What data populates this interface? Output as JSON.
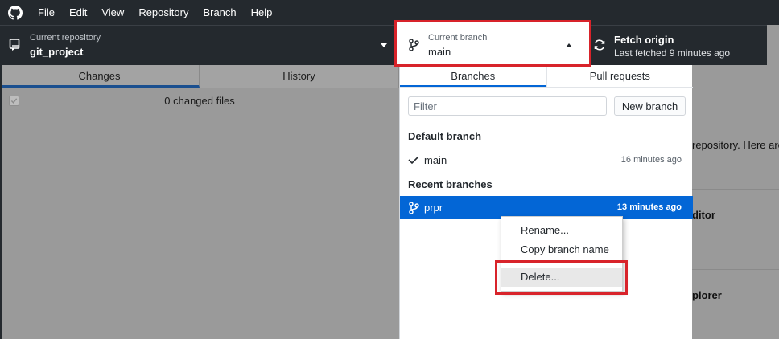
{
  "menu": {
    "logo_icon": "github-icon",
    "items": [
      "File",
      "Edit",
      "View",
      "Repository",
      "Branch",
      "Help"
    ]
  },
  "toolbar": {
    "repo": {
      "label": "Current repository",
      "value": "git_project",
      "icon": "repo-icon"
    },
    "branch": {
      "label": "Current branch",
      "value": "main",
      "icon": "branch-icon"
    },
    "fetch": {
      "label": "Fetch origin",
      "sub": "Last fetched 9 minutes ago",
      "icon": "sync-icon"
    }
  },
  "left_pane": {
    "tabs": [
      "Changes",
      "History"
    ],
    "active_tab": "Changes",
    "changed_files": "0 changed files"
  },
  "right_pane": {
    "text1": "repository. Here are",
    "text2": "ditor",
    "text3": "plorer"
  },
  "dropdown": {
    "tabs": [
      "Branches",
      "Pull requests"
    ],
    "active_tab": "Branches",
    "filter_placeholder": "Filter",
    "new_branch_label": "New branch",
    "default_heading": "Default branch",
    "recent_heading": "Recent branches",
    "default_branch": {
      "name": "main",
      "time": "16 minutes ago"
    },
    "recent_branch": {
      "name": "prpr",
      "time": "13 minutes ago"
    }
  },
  "context_menu": {
    "items": [
      "Rename...",
      "Copy branch name",
      "Delete..."
    ],
    "hovered": "Delete..."
  },
  "colors": {
    "toolbar_bg": "#24292e",
    "accent": "#0366d6",
    "highlight_box": "#d8232a"
  }
}
